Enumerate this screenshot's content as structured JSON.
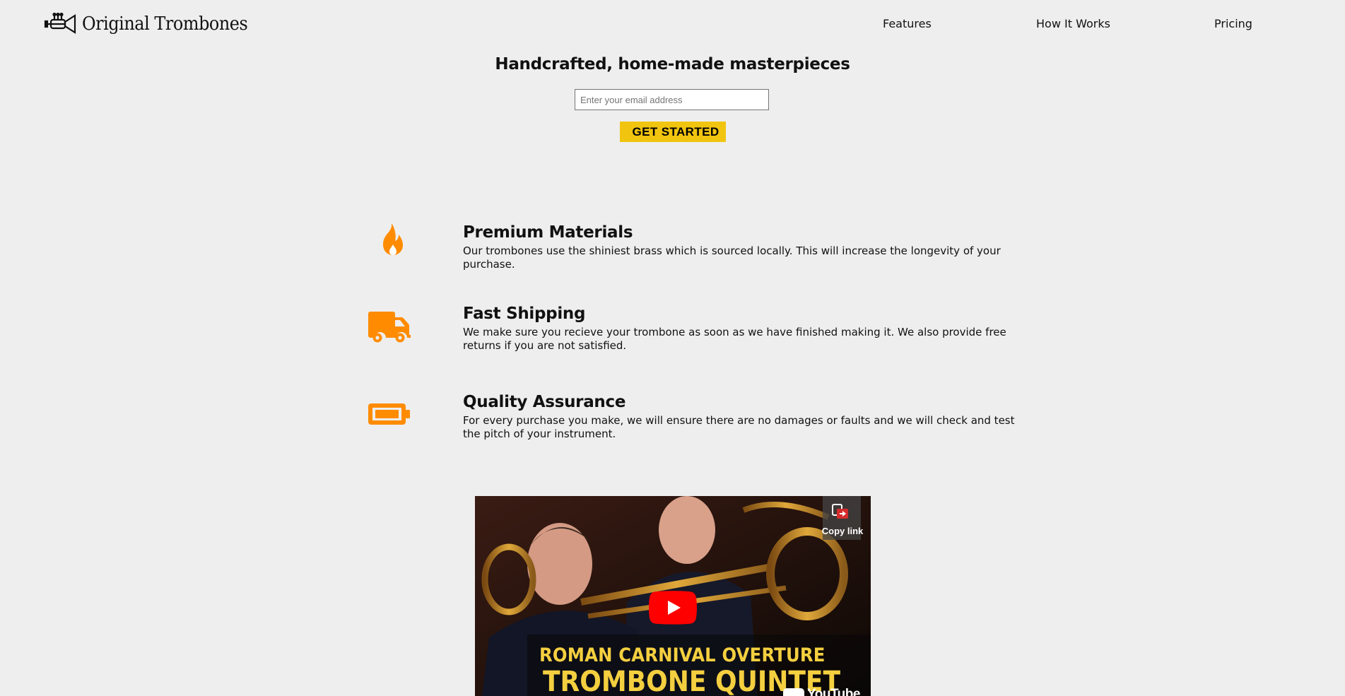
{
  "header": {
    "logo_text": "Original Trombones",
    "nav": {
      "features": "Features",
      "how_it_works": "How It Works",
      "pricing": "Pricing"
    }
  },
  "hero": {
    "title": "Handcrafted, home-made masterpieces",
    "email_placeholder": "Enter your email address",
    "cta_label": "GET STARTED"
  },
  "features": [
    {
      "icon": "flame-icon",
      "title": "Premium Materials",
      "description": "Our trombones use the shiniest brass which is sourced locally. This will increase the longevity of your purchase."
    },
    {
      "icon": "truck-icon",
      "title": "Fast Shipping",
      "description": "We make sure you recieve your trombone as soon as we have finished making it. We also provide free returns if you are not satisfied."
    },
    {
      "icon": "battery-icon",
      "title": "Quality Assurance",
      "description": "For every purchase you make, we will ensure there are no damages or faults and we will check and test the pitch of your instrument."
    }
  ],
  "video": {
    "copy_link_label": "Copy link",
    "caption_line1": "ROMAN CARNIVAL OVERTURE",
    "caption_line2": "TROMBONE QUINTET",
    "platform_label": "YouTube"
  },
  "colors": {
    "background": "#eeeeee",
    "accent_orange": "#ff8c00",
    "cta_yellow": "#f1c40f",
    "play_red": "#ff0000",
    "caption_yellow": "#f4cf3f"
  }
}
